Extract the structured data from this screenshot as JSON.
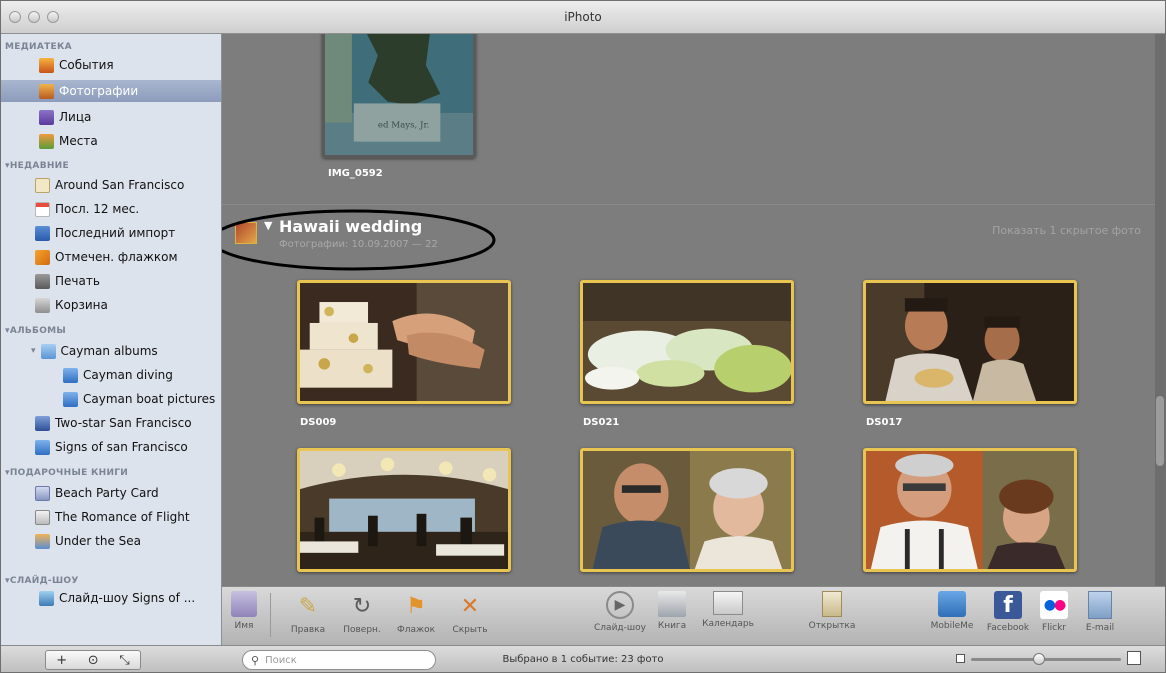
{
  "window": {
    "title": "iPhoto"
  },
  "sidebar": {
    "library": {
      "header": "МЕДИАТЕКА",
      "items": [
        {
          "label": "События",
          "icon": "events-icon"
        },
        {
          "label": "Фотографии",
          "icon": "photos-icon",
          "selected": true
        },
        {
          "label": "Лица",
          "icon": "faces-icon"
        },
        {
          "label": "Места",
          "icon": "places-icon"
        }
      ]
    },
    "recent": {
      "header": "НЕДАВНИЕ",
      "items": [
        {
          "label": "Around San Francisco",
          "icon": "event-icon"
        },
        {
          "label": "Посл. 12 мес.",
          "icon": "calendar-icon"
        },
        {
          "label": "Последний импорт",
          "icon": "import-icon"
        },
        {
          "label": "Отмечен. флажком",
          "icon": "flag-icon"
        },
        {
          "label": "Печать",
          "icon": "print-icon"
        },
        {
          "label": "Корзина",
          "icon": "trash-icon"
        }
      ]
    },
    "albums": {
      "header": "АЛЬБОМЫ",
      "items": [
        {
          "label": "Cayman albums",
          "icon": "folder-icon"
        },
        {
          "label": "Cayman diving",
          "icon": "album-icon"
        },
        {
          "label": "Cayman boat pictures",
          "icon": "album-icon"
        },
        {
          "label": "Two-star San Francisco",
          "icon": "smart-album-icon"
        },
        {
          "label": "Signs of san Francisco",
          "icon": "album-icon"
        }
      ]
    },
    "books": {
      "header": "ПОДАРОЧНЫЕ КНИГИ",
      "items": [
        {
          "label": "Beach Party Card",
          "icon": "card-icon"
        },
        {
          "label": "The Romance of Flight",
          "icon": "calendar-project-icon"
        },
        {
          "label": "Under the Sea",
          "icon": "book-icon"
        }
      ]
    },
    "slideshows": {
      "header": "СЛАЙД-ШОУ",
      "items": [
        {
          "label": "Слайд-шоу Signs of ...",
          "icon": "slideshow-icon"
        }
      ]
    }
  },
  "content": {
    "top_photo_caption": "IMG_0592",
    "event": {
      "title": "Hawaii wedding",
      "subtitle": "Фотографии: 10.09.2007 — 22",
      "show_hidden": "Показать 1 скрытое фото"
    },
    "photos": [
      {
        "caption": "DS009"
      },
      {
        "caption": "DS021"
      },
      {
        "caption": "DS017"
      },
      {
        "caption": ""
      },
      {
        "caption": ""
      },
      {
        "caption": ""
      }
    ]
  },
  "toolbar": {
    "left": [
      {
        "label": "Имя",
        "icon": "info-icon"
      },
      {
        "label": "Правка",
        "icon": "edit-pencil-icon"
      },
      {
        "label": "Поверн.",
        "icon": "rotate-icon"
      },
      {
        "label": "Флажок",
        "icon": "flag-icon"
      },
      {
        "label": "Скрыть",
        "icon": "hide-x-icon"
      }
    ],
    "middle": [
      {
        "label": "Слайд-шоу",
        "icon": "play-icon"
      },
      {
        "label": "Книга",
        "icon": "book-icon"
      },
      {
        "label": "Календарь",
        "icon": "calendar-icon"
      },
      {
        "label": "Открытка",
        "icon": "card-icon"
      }
    ],
    "right": [
      {
        "label": "MobileMe",
        "icon": "mobileme-icon"
      },
      {
        "label": "Facebook",
        "icon": "facebook-icon"
      },
      {
        "label": "Flickr",
        "icon": "flickr-icon"
      },
      {
        "label": "E-mail",
        "icon": "email-icon"
      }
    ]
  },
  "statusbar": {
    "search_placeholder": "Поиск",
    "status_text": "Выбрано в 1 событие: 23 фото",
    "zoom_fraction": 0.45
  }
}
